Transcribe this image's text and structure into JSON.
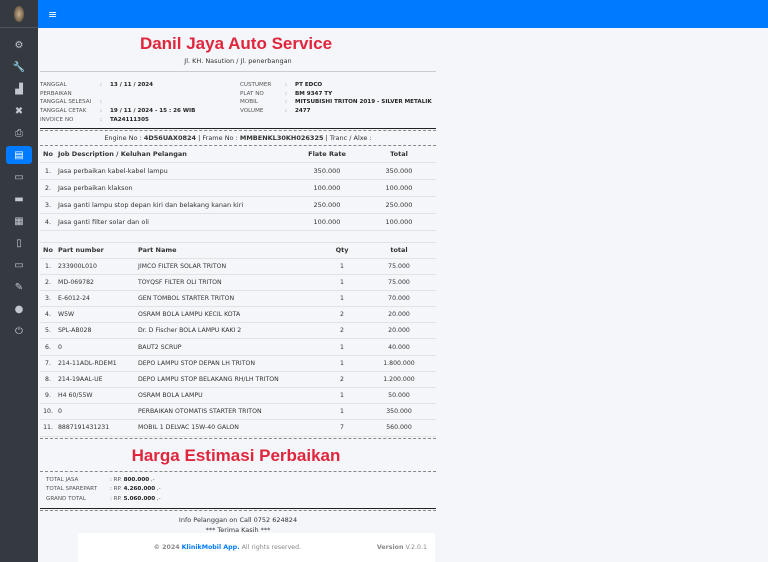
{
  "topbar": {
    "menu_icon": "≡"
  },
  "sidebar": {
    "items": [
      "gears",
      "wrench",
      "truck-loading",
      "tools",
      "print",
      "file-invoice",
      "scroll",
      "box",
      "boxes",
      "file-import",
      "store",
      "file-signature",
      "user-cog",
      "power-off"
    ],
    "active_index": 5
  },
  "header": {
    "title": "Danil Jaya Auto Service",
    "address": "Jl. KH. Nasution / Jl. penerbangan"
  },
  "info_left": [
    {
      "label": "TANGGAL PERBAIKAN",
      "value": "13 / 11 / 2024"
    },
    {
      "label": "TANGGAL SELESAI",
      "value": ""
    },
    {
      "label": "TANGGAL CETAK",
      "value": "19 / 11 / 2024 - 15 : 26 WIB"
    },
    {
      "label": "INVOICE NO",
      "value": "TA24111305"
    }
  ],
  "info_right": [
    {
      "label": "CUSTUMER",
      "value": "PT EDCO"
    },
    {
      "label": "PLAT NO",
      "value": "BM 9347 TY"
    },
    {
      "label": "MOBIL",
      "value": "MITSUBISHI TRITON 2019 - SILVER METALIK"
    },
    {
      "label": "VOLUME",
      "value": "2477"
    }
  ],
  "engine": {
    "engine_label": "Engine No :",
    "engine_value": "4D56UAX0824",
    "frame_label": "| Frame No :",
    "frame_value": "MMBENKL30KH026325",
    "tranc_label": "| Tranc / Alxe :"
  },
  "jobs": {
    "headers": [
      "No",
      "Job Description / Keluhan Pelangan",
      "Flate Rate",
      "Total"
    ],
    "rows": [
      [
        "1.",
        "Jasa perbaikan kabel-kabel lampu",
        "350.000",
        "350.000"
      ],
      [
        "2.",
        "Jasa perbaikan klakson",
        "100.000",
        "100.000"
      ],
      [
        "3.",
        "Jasa ganti lampu stop depan kiri dan belakang kanan kiri",
        "250.000",
        "250.000"
      ],
      [
        "4.",
        "Jasa ganti filter solar dan oli",
        "100.000",
        "100.000"
      ]
    ]
  },
  "parts": {
    "headers": [
      "No",
      "Part number",
      "Part Name",
      "Qty",
      "total"
    ],
    "rows": [
      [
        "1.",
        "233900L010",
        "JIMCO FILTER SOLAR TRITON",
        "1",
        "75.000"
      ],
      [
        "2.",
        "MD-069782",
        "TOYQSF FILTER OLI TRITON",
        "1",
        "75.000"
      ],
      [
        "3.",
        "E-6012-24",
        "GEN TOMBOL STARTER TRITON",
        "1",
        "70.000"
      ],
      [
        "4.",
        "W5W",
        "OSRAM BOLA LAMPU KECIL KOTA",
        "2",
        "20.000"
      ],
      [
        "5.",
        "SPL-AB028",
        "Dr. D Fischer BOLA LAMPU KAKI 2",
        "2",
        "20.000"
      ],
      [
        "6.",
        "0",
        "BAUT2 SCRUP",
        "1",
        "40.000"
      ],
      [
        "7.",
        "214-11ADL-RDEM1",
        "DEPO LAMPU STOP DEPAN LH TRITON",
        "1",
        "1.800.000"
      ],
      [
        "8.",
        "214-19AAL-UE",
        "DEPO LAMPU STOP BELAKANG RH/LH TRITON",
        "2",
        "1.200.000"
      ],
      [
        "9.",
        "H4 60/55W",
        "OSRAM BOLA LAMPU",
        "1",
        "50.000"
      ],
      [
        "10.",
        "0",
        "PERBAIKAN OTOMATIS STARTER TRITON",
        "1",
        "350.000"
      ],
      [
        "11.",
        "8887191431231",
        "MOBIL 1 DELVAC 15W-40 GALON",
        "7",
        "560.000"
      ]
    ]
  },
  "estimate_title": "Harga Estimasi Perbaikan",
  "totals": [
    {
      "label": "TOTAL JASA",
      "prefix": ": RP.",
      "value": "800.000",
      "suffix": ",-"
    },
    {
      "label": "TOTAL SPAREPART",
      "prefix": ": RP.",
      "value": "4.260.000",
      "suffix": ",-"
    },
    {
      "label": "GRAND TOTAL",
      "prefix": ": RP.",
      "value": "5.060.000",
      "suffix": ",-"
    }
  ],
  "closing": {
    "info": "Info Pelanggan on Call 0752 624824",
    "thanks": "*** Terima Kasih ***"
  },
  "footer": {
    "copyright": "© 2024",
    "brand": "KlinikMobil App.",
    "rights": "All rights reserved.",
    "version_label": "Version",
    "version": "V.2.0.1"
  }
}
